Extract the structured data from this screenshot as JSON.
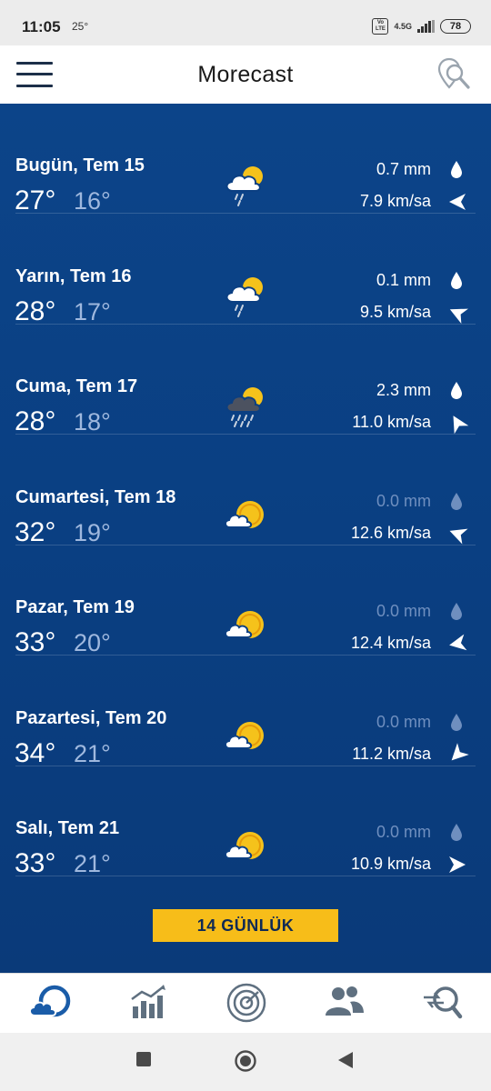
{
  "status_bar": {
    "time": "11:05",
    "temp": "25°",
    "volte": "Vo LTE",
    "network": "4.5G",
    "battery": "78"
  },
  "header": {
    "title": "Morecast",
    "menu_icon": "hamburger-menu-icon",
    "right_icon": "location-search-icon"
  },
  "forecast": [
    {
      "day": "Bugün, Tem 15",
      "max": "27°",
      "min": "16°",
      "precip": "0.7 mm",
      "wind": "7.9 km/sa",
      "icon": "rain-sun-cloud-icon",
      "wind_dir_deg": 180
    },
    {
      "day": "Yarın, Tem 16",
      "max": "28°",
      "min": "17°",
      "precip": "0.1 mm",
      "wind": "9.5 km/sa",
      "icon": "rain-sun-cloud-icon",
      "wind_dir_deg": 205
    },
    {
      "day": "Cuma, Tem 17",
      "max": "28°",
      "min": "18°",
      "precip": "2.3 mm",
      "wind": "11.0 km/sa",
      "icon": "heavy-rain-cloud-icon",
      "wind_dir_deg": 240
    },
    {
      "day": "Cumartesi, Tem 18",
      "max": "32°",
      "min": "19°",
      "precip": "0.0 mm",
      "wind": "12.6 km/sa",
      "icon": "sun-cloud-icon",
      "wind_dir_deg": 200
    },
    {
      "day": "Pazar, Tem 19",
      "max": "33°",
      "min": "20°",
      "precip": "0.0 mm",
      "wind": "12.4 km/sa",
      "icon": "sun-cloud-icon",
      "wind_dir_deg": 170
    },
    {
      "day": "Pazartesi, Tem 20",
      "max": "34°",
      "min": "21°",
      "precip": "0.0 mm",
      "wind": "11.2 km/sa",
      "icon": "sun-cloud-icon",
      "wind_dir_deg": 135
    },
    {
      "day": "Salı, Tem 21",
      "max": "33°",
      "min": "21°",
      "precip": "0.0 mm",
      "wind": "10.9 km/sa",
      "icon": "sun-cloud-icon",
      "wind_dir_deg": 0
    }
  ],
  "button_14": "14 GÜNLÜK",
  "bottom_nav": [
    "weather-icon",
    "chart-icon",
    "radar-icon",
    "community-icon",
    "compare-icon"
  ],
  "colors": {
    "panel": "#0a3f82",
    "accent": "#f7bd19",
    "sun": "#f5c21b",
    "nav_blue": "#1a5ca8",
    "nav_grey": "#5f7080"
  }
}
